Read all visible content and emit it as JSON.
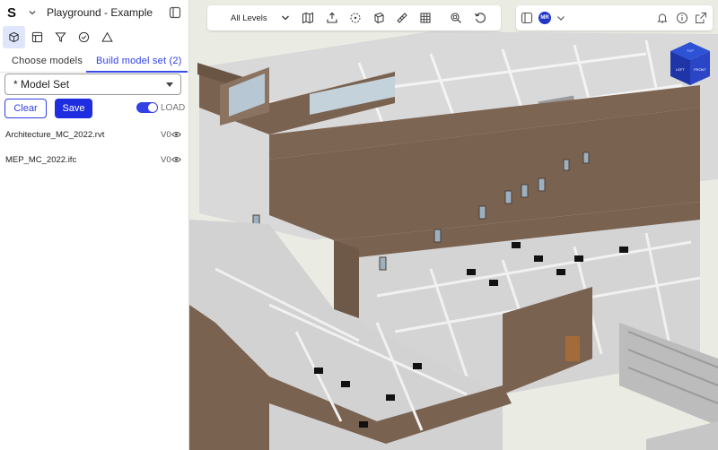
{
  "app": {
    "logo": "S",
    "project_title": "Playground - Example"
  },
  "tool_icons": [
    "cube-icon",
    "layout-icon",
    "filter-icon",
    "check-circle-icon",
    "triangle-icon"
  ],
  "tabs": {
    "choose_models": "Choose models",
    "build_model_set": "Build model set (2)",
    "active": "build_model_set"
  },
  "model_set": {
    "selected": "* Model Set"
  },
  "buttons": {
    "clear": "Clear",
    "save": "Save"
  },
  "load_toggle": {
    "label": "LOAD",
    "on": true
  },
  "models": [
    {
      "name": "Architecture_MC_2022.rvt",
      "version": "V0"
    },
    {
      "name": "MEP_MC_2022.ifc",
      "version": "V0"
    }
  ],
  "toolbar": {
    "levels_label": "All Levels"
  },
  "user": {
    "initials": "MR"
  },
  "view_cube": {
    "top": "TOP",
    "left": "LEFT",
    "front": "FRONT"
  },
  "colors": {
    "accent": "#1f2de0",
    "building_brick": "#7a6250",
    "panel_bg": "#ffffff",
    "ground": "#e9ebe4"
  }
}
